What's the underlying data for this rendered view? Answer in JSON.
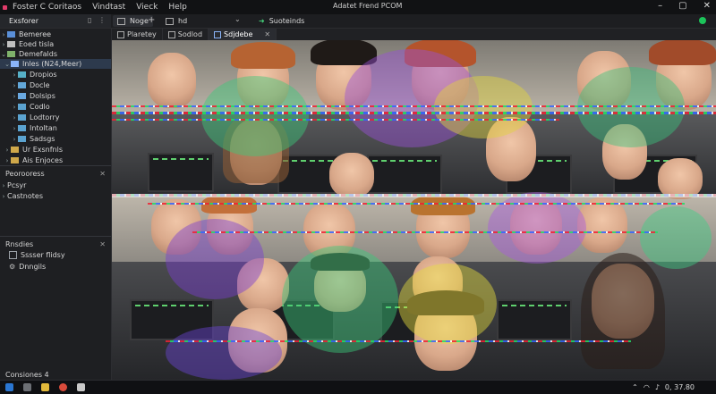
{
  "titlebar": {
    "menu": [
      "Foster C Coritaos",
      "Vindtast",
      "Vieck",
      "Help"
    ],
    "app_title": "Adatet Frend PCOM"
  },
  "top_tabs": [
    {
      "label": "Noge",
      "icon": "image-icon"
    },
    {
      "label": "hd",
      "icon": "image-icon"
    },
    {
      "label": "Suoteinds",
      "icon": "arrow-icon"
    }
  ],
  "sidebar": {
    "header": "Exsforer",
    "tree": [
      {
        "label": "Bemeree",
        "level": 0
      },
      {
        "label": "Eoed tisla",
        "level": 0
      },
      {
        "label": "Demefalds",
        "level": 0
      },
      {
        "label": "Inles (N24,Meer)",
        "level": 1,
        "selected": true
      },
      {
        "label": "Dropios",
        "level": 2
      },
      {
        "label": "Docle",
        "level": 2
      },
      {
        "label": "Dolsips",
        "level": 2
      },
      {
        "label": "Codlo",
        "level": 2
      },
      {
        "label": "Lodtorry",
        "level": 2
      },
      {
        "label": "Intoltan",
        "level": 2
      },
      {
        "label": "Sadsgs",
        "level": 2
      },
      {
        "label": "Ur Exsnfnls",
        "level": 1
      },
      {
        "label": "Ais Enjoces",
        "level": 1
      }
    ],
    "section2": {
      "title": "Peorooress",
      "items": [
        "Pcsyr",
        "Castnotes"
      ]
    },
    "section3": {
      "title": "Rnsdies",
      "items": [
        "Sssser flidsy",
        "Dnngils"
      ]
    },
    "status": "Consiones  4"
  },
  "editor_tabs": [
    {
      "label": "Plaretey",
      "icon": "image-icon"
    },
    {
      "label": "Sodlod",
      "icon": "image-icon"
    },
    {
      "label": "Sdjdebe",
      "icon": "image-icon",
      "active": true
    }
  ],
  "taskbar": {
    "clock": "0, 37.80"
  },
  "colors": {
    "accent_green": "#1cc45a",
    "selection": "#2d3a4d",
    "brand": "#e23b6a"
  }
}
